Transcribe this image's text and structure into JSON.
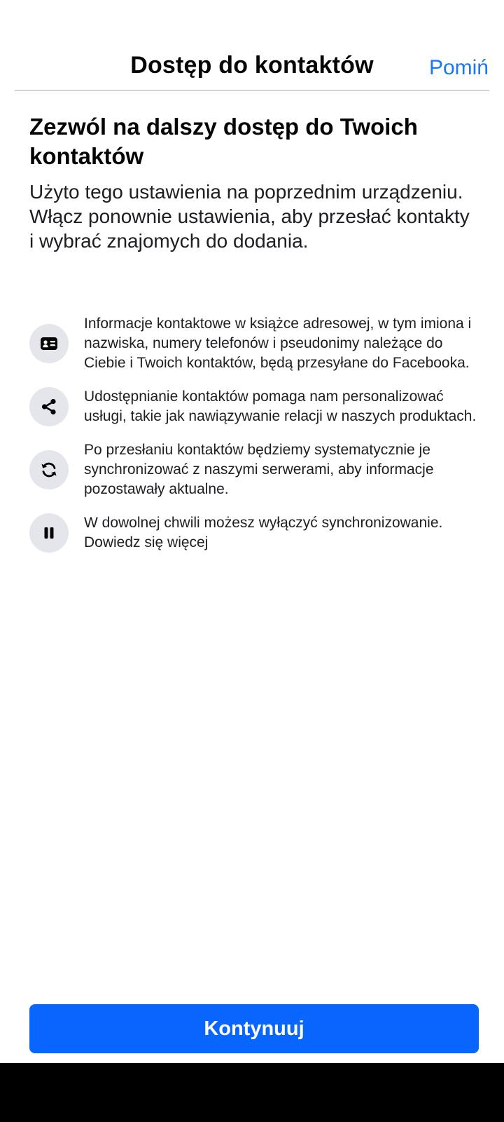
{
  "header": {
    "title": "Dostęp do kontaktów",
    "skip_label": "Pomiń",
    "accent_color": "#1877f2"
  },
  "main": {
    "heading": "Zezwól na dalszy dostęp do Twoich kontaktów",
    "description": "Użyto tego ustawienia na poprzednim urządzeniu. Włącz ponownie ustawienia, aby przesłać kontakty i wybrać znajomych do dodania."
  },
  "info_items": [
    {
      "icon": "contact-card-icon",
      "text": "Informacje kontaktowe w książce adresowej, w tym imiona i nazwiska, numery telefonów i pseudonimy należące do Ciebie i Twoich kontaktów, będą przesyłane do Facebooka."
    },
    {
      "icon": "share-icon",
      "text": "Udostępnianie kontaktów pomaga nam personalizować usługi, takie jak nawiązywanie relacji w naszych produktach."
    },
    {
      "icon": "sync-icon",
      "text": "Po przesłaniu kontaktów będziemy systematycznie je synchronizować z naszymi serwerami, aby informacje pozostawały aktualne."
    },
    {
      "icon": "pause-icon",
      "text": "W dowolnej chwili możesz wyłączyć synchronizowanie.",
      "link": "Dowiedz się więcej"
    }
  ],
  "footer": {
    "continue_label": "Kontynuuj",
    "button_color": "#0866ff"
  }
}
